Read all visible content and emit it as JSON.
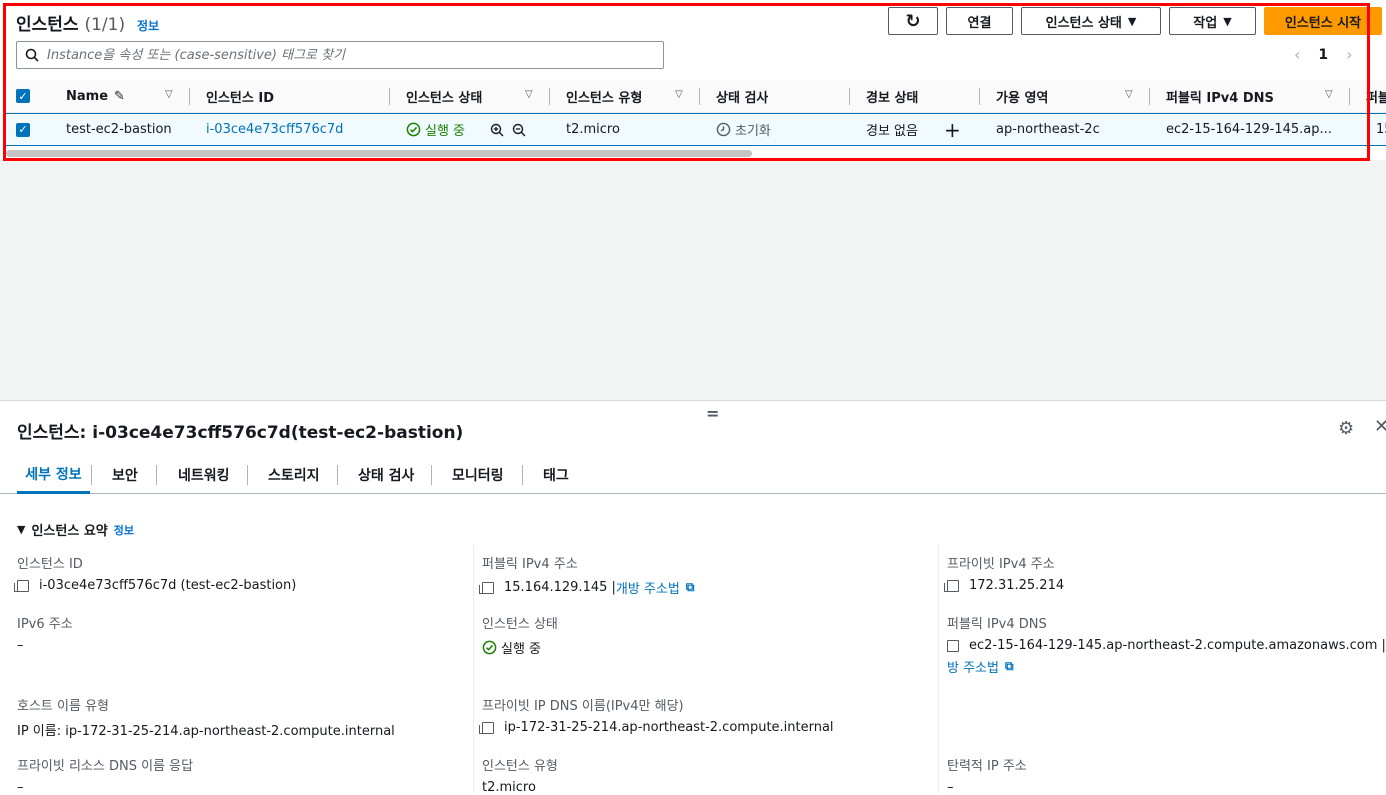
{
  "instances": {
    "title": "인스턴스",
    "count": "(1/1)",
    "info": "정보",
    "buttons": {
      "refresh": "↻",
      "connect": "연결",
      "state": "인스턴스 상태",
      "actions": "작업",
      "launch": "인스턴스 시작"
    },
    "search_placeholder": "Instance을 속성 또는 (case-sensitive) 태그로 찾기",
    "page": "1",
    "columns": [
      "Name",
      "인스턴스 ID",
      "인스턴스 상태",
      "인스턴스 유형",
      "상태 검사",
      "경보 상태",
      "가용 영역",
      "퍼블릭 IPv4 DNS",
      "퍼블"
    ],
    "row": {
      "name": "test-ec2-bastion",
      "id": "i-03ce4e73cff576c7d",
      "state": "실행 중",
      "type": "t2.micro",
      "check": "초기화",
      "alarm": "경보 없음",
      "az": "ap-northeast-2c",
      "dns": "ec2-15-164-129-145.ap...",
      "extra": "15."
    }
  },
  "detail": {
    "title": "인스턴스: i-03ce4e73cff576c7d(test-ec2-bastion)",
    "tabs": [
      "세부 정보",
      "보안",
      "네트워킹",
      "스토리지",
      "상태 검사",
      "모니터링",
      "태그"
    ],
    "section": "인스턴스 요약",
    "section_info": "정보",
    "fields": {
      "instance_id_label": "인스턴스 ID",
      "instance_id_value": "i-03ce4e73cff576c7d (test-ec2-bastion)",
      "public_ip_label": "퍼블릭 IPv4 주소",
      "public_ip_value": "15.164.129.145 |",
      "public_ip_link": "개방 주소법",
      "private_ip_label": "프라이빗 IPv4 주소",
      "private_ip_value": "172.31.25.214",
      "ipv6_label": "IPv6 주소",
      "ipv6_value": "–",
      "state_label": "인스턴스 상태",
      "state_value": "실행 중",
      "public_dns_label": "퍼블릭 IPv4 DNS",
      "public_dns_value": "ec2-15-164-129-145.ap-northeast-2.compute.amazonaws.com |",
      "public_dns_link": "방 주소법",
      "hostname_label": "호스트 이름 유형",
      "hostname_value": "IP 이름: ip-172-31-25-214.ap-northeast-2.compute.internal",
      "private_dns_label": "프라이빗 IP DNS 이름(IPv4만 해당)",
      "private_dns_value": "ip-172-31-25-214.ap-northeast-2.compute.internal",
      "resource_dns_label": "프라이빗 리소스 DNS 이름 응답",
      "resource_dns_value": "–",
      "type_label": "인스턴스 유형",
      "type_value": "t2.micro",
      "eip_label": "탄력적 IP 주소",
      "eip_value": "–"
    }
  },
  "colors": {
    "accent": "#0073bb",
    "primary_button": "#ff9900",
    "running": "#1d8102",
    "highlight": "#ff0000"
  }
}
